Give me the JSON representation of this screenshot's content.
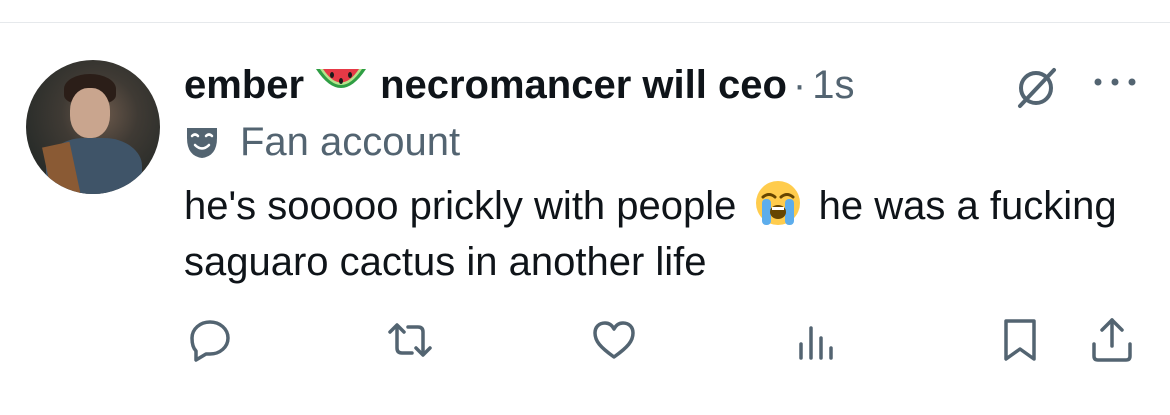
{
  "post": {
    "author_name": "ember",
    "author_name_rest": "necromancer will ceo",
    "separator": "·",
    "timestamp": "1s",
    "label": "Fan account",
    "text_before_emoji": "he's sooooo prickly with people",
    "text_after_emoji": "he was a fucking saguaro cactus in another life"
  },
  "icons": {
    "name_emoji": "watermelon-emoji",
    "text_emoji": "loudly-crying-face-emoji",
    "label_icon": "theater-mask-icon",
    "grok": "grok-icon",
    "more": "more-icon",
    "reply": "reply-icon",
    "retweet": "retweet-icon",
    "like": "like-icon",
    "views": "views-icon",
    "bookmark": "bookmark-icon",
    "share": "share-icon"
  },
  "colors": {
    "text_primary": "#0f1419",
    "text_secondary": "#536471",
    "divider": "#e6e9ec"
  }
}
